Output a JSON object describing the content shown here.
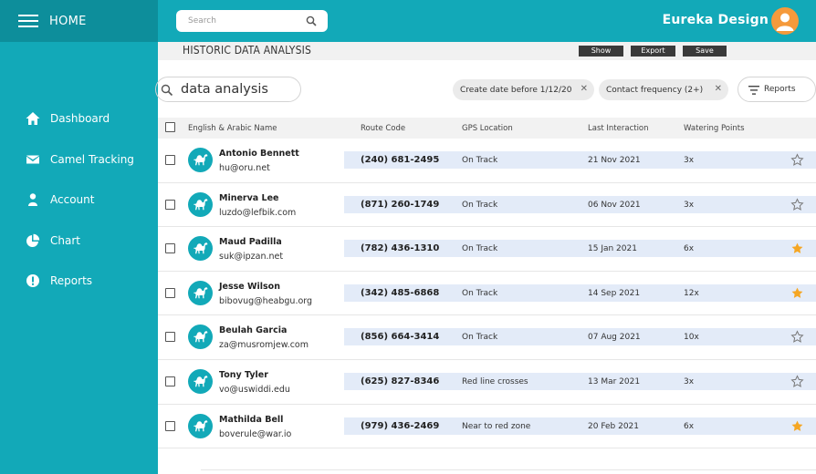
{
  "sidebar": {
    "home_label": "HOME",
    "items": [
      {
        "label": "Dashboard",
        "icon": "home-icon"
      },
      {
        "label": "Camel Tracking",
        "icon": "envelope-icon"
      },
      {
        "label": "Account",
        "icon": "person-icon"
      },
      {
        "label": "Chart",
        "icon": "pie-chart-icon"
      },
      {
        "label": "Reports",
        "icon": "warning-icon"
      }
    ]
  },
  "header": {
    "search_placeholder": "Search",
    "brand": "Eureka Design",
    "avatar_icon": "user-avatar-icon"
  },
  "titlebar": {
    "title": "HISTORIC DATA ANALYSIS",
    "show_label": "Show",
    "export_label": "Export",
    "save_label": "Save"
  },
  "query": {
    "value": "data analysis",
    "chips": [
      "Create date before 1/12/20",
      "Contact frequency (2+)"
    ],
    "reports_label": "Reports"
  },
  "table": {
    "columns": [
      "English & Arabic Name",
      "Route Code",
      "GPS Location",
      "Last Interaction",
      "Watering Points"
    ],
    "rows": [
      {
        "name": "Antonio Bennett",
        "email": "hu@oru.net",
        "phone": "(240) 681-2495",
        "gps": "On Track",
        "last": "21 Nov 2021",
        "water": "3x",
        "starred": false
      },
      {
        "name": "Minerva Lee",
        "email": "luzdo@lefbik.com",
        "phone": "(871) 260-1749",
        "gps": "On Track",
        "last": "06 Nov 2021",
        "water": "3x",
        "starred": false
      },
      {
        "name": "Maud Padilla",
        "email": "suk@ipzan.net",
        "phone": "(782) 436-1310",
        "gps": "On Track",
        "last": "15 Jan 2021",
        "water": "6x",
        "starred": true
      },
      {
        "name": "Jesse Wilson",
        "email": "bibovug@heabgu.org",
        "phone": "(342) 485-6868",
        "gps": "On Track",
        "last": "14 Sep 2021",
        "water": "12x",
        "starred": true
      },
      {
        "name": "Beulah Garcia",
        "email": "za@musromjew.com",
        "phone": "(856) 664-3414",
        "gps": "On Track",
        "last": "07 Aug 2021",
        "water": "10x",
        "starred": false
      },
      {
        "name": "Tony Tyler",
        "email": "vo@uswiddi.edu",
        "phone": "(625) 827-8346",
        "gps": "Red line crosses",
        "last": "13 Mar 2021",
        "water": "3x",
        "starred": false
      },
      {
        "name": "Mathilda Bell",
        "email": "boverule@war.io",
        "phone": "(979) 436-2469",
        "gps": "Near to red zone",
        "last": "20 Feb 2021",
        "water": "6x",
        "starred": true
      }
    ]
  },
  "colors": {
    "accent": "#12a9b8",
    "accent_dark": "#0d8e9b",
    "star": "#f5a623",
    "avatar": "#f59a3b",
    "row_band": "#e3ebf8"
  }
}
